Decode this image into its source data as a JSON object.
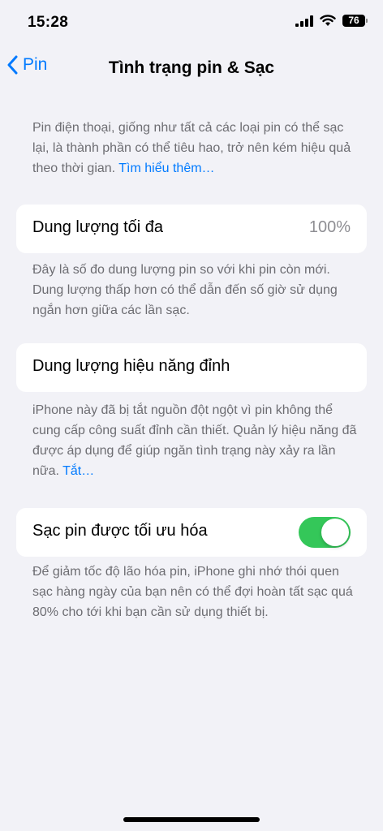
{
  "status": {
    "time": "15:28",
    "battery": "76"
  },
  "nav": {
    "back_label": "Pin",
    "title": "Tình trạng pin & Sạc"
  },
  "intro": {
    "text": "Pin điện thoại, giống như tất cả các loại pin có thể sạc lại, là thành phần có thể tiêu hao, trở nên kém hiệu quả theo thời gian. ",
    "link": "Tìm hiểu thêm…"
  },
  "max_capacity": {
    "label": "Dung lượng tối đa",
    "value": "100%",
    "desc": "Đây là số đo dung lượng pin so với khi pin còn mới. Dung lượng thấp hơn có thể dẫn đến số giờ sử dụng ngắn hơn giữa các lần sạc."
  },
  "peak_performance": {
    "label": "Dung lượng hiệu năng đỉnh",
    "desc": "iPhone này đã bị tắt nguồn đột ngột vì pin không thể cung cấp công suất đỉnh cần thiết. Quản lý hiệu năng đã được áp dụng để giúp ngăn tình trạng này xảy ra lần nữa. ",
    "link": "Tắt…"
  },
  "optimized_charging": {
    "label": "Sạc pin được tối ưu hóa",
    "enabled": true,
    "desc": "Để giảm tốc độ lão hóa pin, iPhone ghi nhớ thói quen sạc hàng ngày của bạn nên có thể đợi hoàn tất sạc quá 80% cho tới khi bạn cần sử dụng thiết bị."
  }
}
